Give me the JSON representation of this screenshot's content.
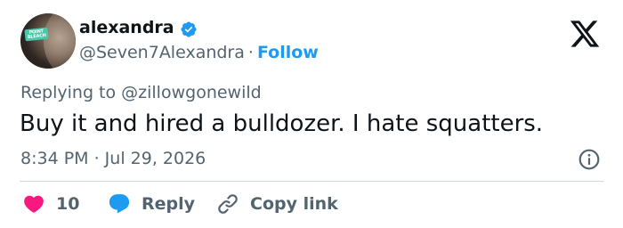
{
  "user": {
    "display_name": "alexandra",
    "handle": "@Seven7Alexandra",
    "separator": "·",
    "follow_label": "Follow",
    "avatar_badge_text": [
      "POINT",
      "BLEACH"
    ]
  },
  "tweet": {
    "replying_to": "Replying to @zillowgonewild",
    "text": "Buy it and hired a bulldozer. I hate squatters.",
    "timestamp": "8:34 PM · Jul 29, 2026"
  },
  "actions": {
    "like_count": "10",
    "reply_label": "Reply",
    "copy_link_label": "Copy link"
  },
  "icons": {
    "verified": "verified-badge-icon",
    "platform": "x-logo-icon",
    "info": "info-icon",
    "like": "heart-icon",
    "reply": "speech-bubble-icon",
    "copy": "link-icon"
  },
  "colors": {
    "accent": "#1d9bf0",
    "like": "#f91880",
    "text_primary": "#0f1419",
    "text_secondary": "#536471",
    "divider": "#cfd9de"
  }
}
